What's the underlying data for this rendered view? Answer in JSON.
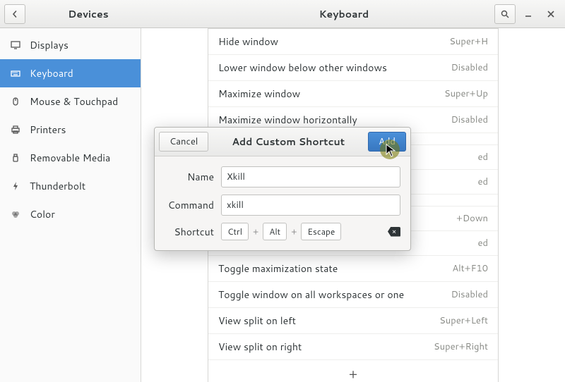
{
  "header": {
    "left_title": "Devices",
    "center_title": "Keyboard"
  },
  "sidebar": {
    "items": [
      {
        "label": "Displays"
      },
      {
        "label": "Keyboard"
      },
      {
        "label": "Mouse & Touchpad"
      },
      {
        "label": "Printers"
      },
      {
        "label": "Removable Media"
      },
      {
        "label": "Thunderbolt"
      },
      {
        "label": "Color"
      }
    ]
  },
  "shortcuts": [
    {
      "label": "Hide window",
      "value": "Super+H"
    },
    {
      "label": "Lower window below other windows",
      "value": "Disabled"
    },
    {
      "label": "Maximize window",
      "value": "Super+Up"
    },
    {
      "label": "Maximize window horizontally",
      "value": "Disabled"
    },
    {
      "label": "",
      "value": ""
    },
    {
      "label": "",
      "value": "ed"
    },
    {
      "label": "",
      "value": "ed"
    },
    {
      "label": "",
      "value": ""
    },
    {
      "label": "",
      "value": "+Down"
    },
    {
      "label": "",
      "value": "ed"
    },
    {
      "label": "Toggle maximization state",
      "value": "Alt+F10"
    },
    {
      "label": "Toggle window on all workspaces or one",
      "value": "Disabled"
    },
    {
      "label": "View split on left",
      "value": "Super+Left"
    },
    {
      "label": "View split on right",
      "value": "Super+Right"
    }
  ],
  "add_row": "+",
  "dialog": {
    "title": "Add Custom Shortcut",
    "cancel": "Cancel",
    "add": "Add",
    "name_label": "Name",
    "name_value": "Xkill",
    "command_label": "Command",
    "command_value": "xkill",
    "shortcut_label": "Shortcut",
    "keys": [
      "Ctrl",
      "Alt",
      "Escape"
    ],
    "plus": "+"
  }
}
